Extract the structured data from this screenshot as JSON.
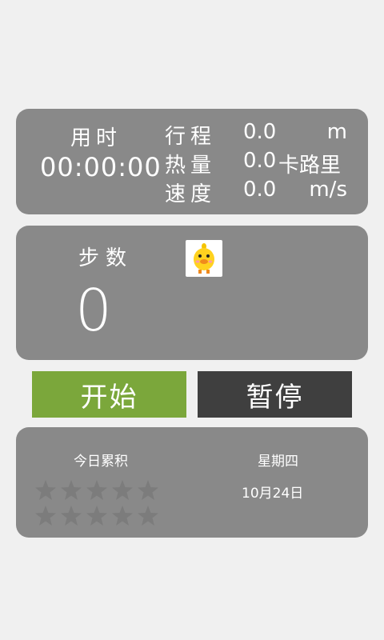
{
  "colors": {
    "card_bg": "#898989",
    "start_button": "#7ba73b",
    "pause_button": "#3f3f3f",
    "page_bg": "#f0f0f0",
    "star_empty": "#7c7c7c"
  },
  "stats": {
    "elapsed_label": "用时",
    "elapsed_value": "00:00:00",
    "distance_label": "行程",
    "distance_value": "0.0",
    "distance_unit": "m",
    "calories_label": "热量",
    "calories_value": "0.0",
    "calories_unit": "卡路里",
    "speed_label": "速度",
    "speed_value": "0.0",
    "speed_unit": "m/s"
  },
  "steps": {
    "label": "步数",
    "value": "0",
    "icon": "chick-icon"
  },
  "buttons": {
    "start_label": "开始",
    "pause_label": "暂停"
  },
  "history": {
    "today_label": "今日累积",
    "weekday": "星期四",
    "date": "10月24日",
    "stars_filled": 0,
    "stars_total": 10
  }
}
